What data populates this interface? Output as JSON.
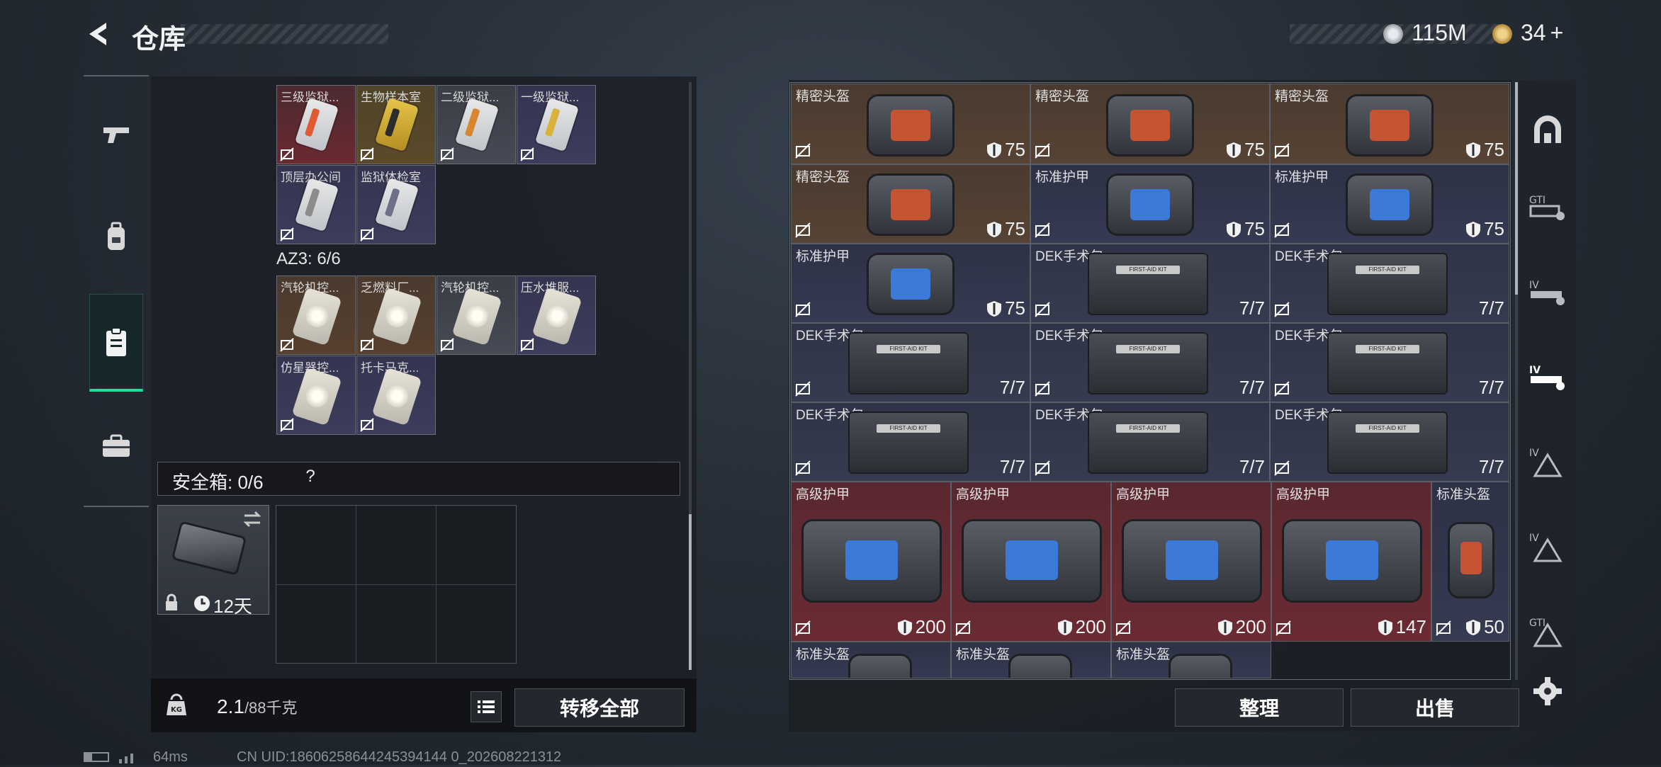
{
  "header": {
    "title": "仓库",
    "currency1": "115M",
    "currency2": "34",
    "currency2_plus": "+"
  },
  "left_nav": [
    "weapon",
    "backpack",
    "clipboard",
    "briefcase"
  ],
  "key_cards_top": [
    {
      "name": "三级监狱...",
      "color": "red",
      "stripe": "#e05a32"
    },
    {
      "name": "生物样本室",
      "color": "gold",
      "stripe": "#2c2c2c"
    },
    {
      "name": "二级监狱...",
      "color": "gray",
      "stripe": "#d8862f"
    },
    {
      "name": "一级监狱...",
      "color": "purple",
      "stripe": "#d9b23a"
    },
    {
      "name": "顶层办公间",
      "color": "purple",
      "stripe": "#8c8c8c"
    },
    {
      "name": "监狱体检室",
      "color": "purple",
      "stripe": "#6f6f8a"
    }
  ],
  "az3": {
    "label": "AZ3: 6/6"
  },
  "disc_cards": [
    {
      "name": "汽轮机控..."
    },
    {
      "name": "乏燃料厂..."
    },
    {
      "name": "汽轮机控..."
    },
    {
      "name": "压水堆服..."
    },
    {
      "name": "仿星器控..."
    },
    {
      "name": "托卡马克..."
    }
  ],
  "safe_box": {
    "label": "安全箱: 0/6",
    "help": "?",
    "duration": "12天"
  },
  "bottom": {
    "weight": "2.1",
    "weight_max": "/88千克",
    "transfer_all": "转移全部",
    "kg": "KG"
  },
  "stash_rows": [
    [
      {
        "name": "精密头盔",
        "type": "helm",
        "value": "75"
      },
      {
        "name": "精密头盔",
        "type": "helm",
        "value": "75"
      },
      {
        "name": "精密头盔",
        "type": "helm",
        "value": "75"
      }
    ],
    [
      {
        "name": "精密头盔",
        "type": "helm",
        "value": "75"
      },
      {
        "name": "标准护甲",
        "type": "armor",
        "value": "75"
      },
      {
        "name": "标准护甲",
        "type": "armor",
        "value": "75"
      }
    ],
    [
      {
        "name": "标准护甲",
        "type": "armor",
        "value": "75"
      },
      {
        "name": "DEK手术包",
        "type": "kit",
        "value": "7/7"
      },
      {
        "name": "DEK手术包",
        "type": "kit",
        "value": "7/7"
      }
    ],
    [
      {
        "name": "DEK手术包",
        "type": "kit",
        "value": "7/7"
      },
      {
        "name": "DEK手术包",
        "type": "kit",
        "value": "7/7"
      },
      {
        "name": "DEK手术包",
        "type": "kit",
        "value": "7/7"
      }
    ],
    [
      {
        "name": "DEK手术包",
        "type": "kit",
        "value": "7/7"
      },
      {
        "name": "DEK手术包",
        "type": "kit",
        "value": "7/7"
      },
      {
        "name": "DEK手术包",
        "type": "kit",
        "value": "7/7"
      }
    ]
  ],
  "kit_label": "FIRST-AID KIT",
  "high_row": [
    {
      "name": "高级护甲",
      "value": "200"
    },
    {
      "name": "高级护甲",
      "value": "200"
    },
    {
      "name": "高级护甲",
      "value": "200"
    },
    {
      "name": "高级护甲",
      "value": "147"
    },
    {
      "name": "标准头盔",
      "value": "50"
    }
  ],
  "partial_row": [
    "标准头盔",
    "标准头盔",
    "标准头盔"
  ],
  "actions": {
    "sort": "整理",
    "sell": "出售"
  },
  "right_sidebar": [
    "GTI",
    "IV",
    "IV",
    "IV",
    "IV",
    "GTI"
  ],
  "status": {
    "ping": "64ms",
    "uid": "CN UID:18606258644245394144 0_202608221312"
  },
  "colors": {
    "accent": "#1fe09b",
    "helm_bg": "#564334",
    "armor_bg": "#363a52",
    "high_bg": "#6b2b33"
  }
}
